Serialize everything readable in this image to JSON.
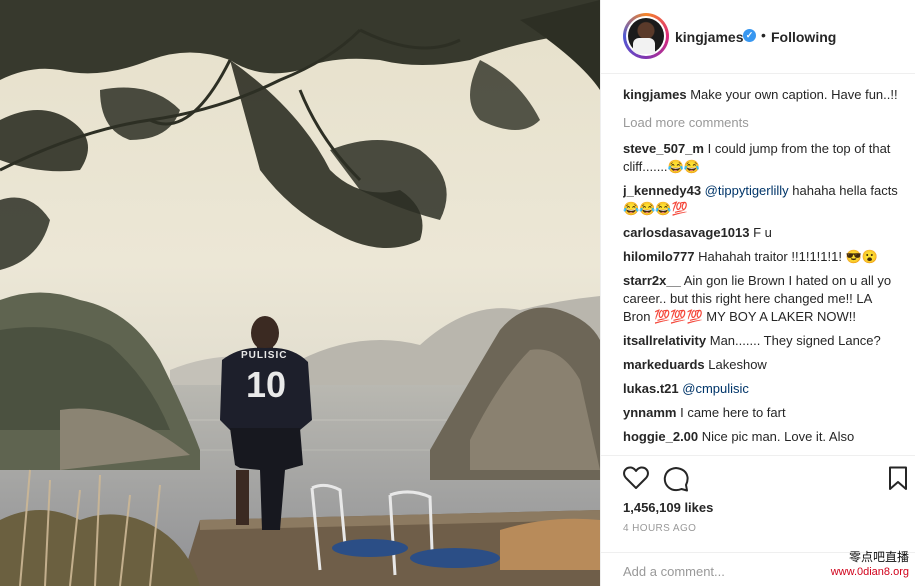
{
  "post": {
    "username": "kingjames",
    "verified_glyph": "✓",
    "separator": "•",
    "follow_status": "Following",
    "caption": "Make your own caption. Have fun..!!",
    "load_more": "Load more comments",
    "likes": "1,456,109 likes",
    "time": "4 HOURS AGO",
    "add_comment_placeholder": "Add a comment...",
    "jersey_name": "PULISIC",
    "jersey_number": "10"
  },
  "comments": [
    {
      "user": "steve_507_m",
      "text": "I could jump from the top of that cliff.......😂😂"
    },
    {
      "user": "j_kennedy43",
      "mention": "@tippytigerlilly",
      "text": " hahaha hella facts 😂😂😂💯"
    },
    {
      "user": "carlosdasavage1013",
      "text": "F u"
    },
    {
      "user": "hilomilo777",
      "text": "Hahahah traitor !!1!1!1!1! 😎😮"
    },
    {
      "user": "starr2x__",
      "text": "Ain gon lie Brown I hated on u all yo career.. but this right here changed me!! LA Bron 💯💯💯 MY BOY A LAKER NOW!!"
    },
    {
      "user": "itsallrelativity",
      "text": "Man....... They signed Lance?"
    },
    {
      "user": "markeduards",
      "text": "Lakeshow"
    },
    {
      "user": "lukas.t21",
      "mention": "@cmpulisic",
      "text": ""
    },
    {
      "user": "ynnamm",
      "text": "I came here to fart"
    },
    {
      "user": "hoggie_2.00",
      "text": "Nice pic man. Love it. Also"
    }
  ],
  "icons": {
    "like": "heart-icon",
    "comment": "comment-icon",
    "save": "bookmark-icon"
  },
  "watermark": {
    "line1": "零点吧直播",
    "line2": "www.0dian8.org"
  },
  "colors": {
    "link": "#003569",
    "meta": "#999999",
    "verified": "#3897f0"
  }
}
